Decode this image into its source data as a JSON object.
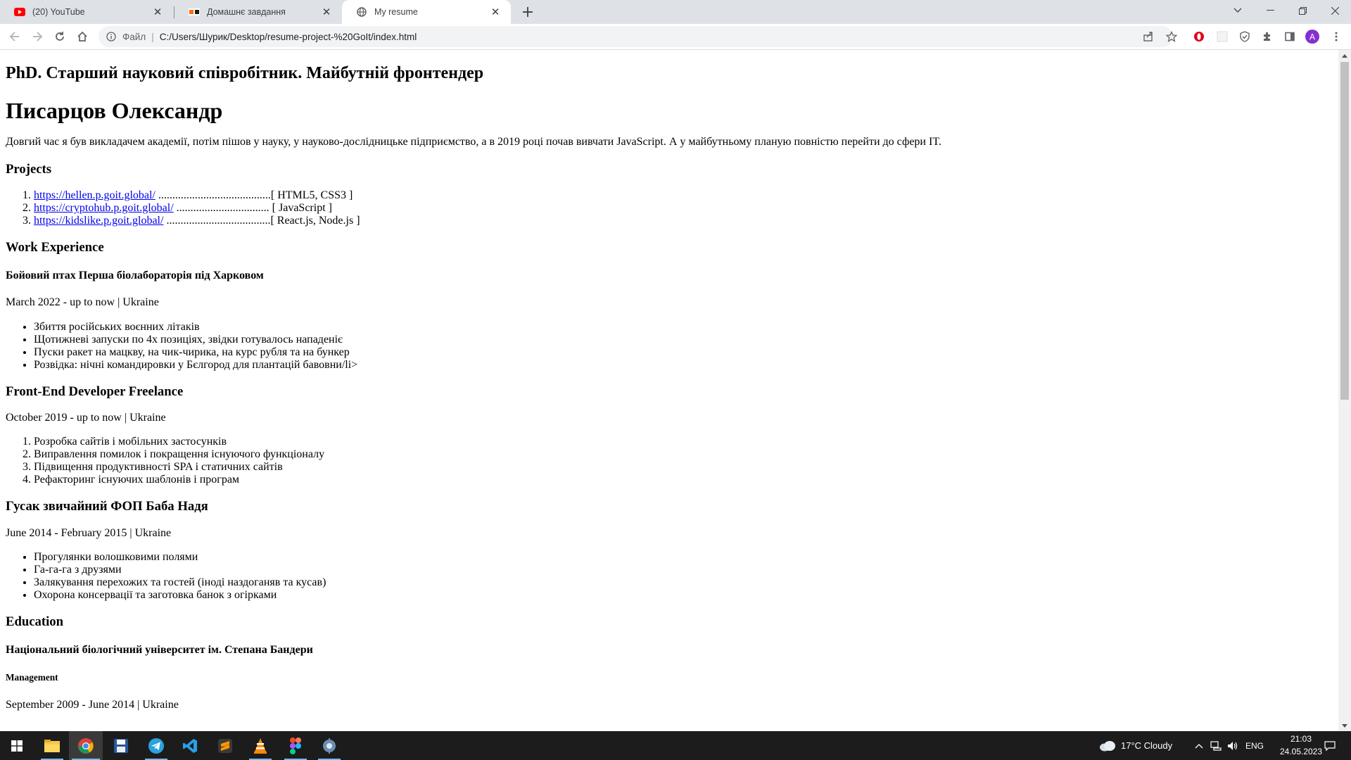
{
  "browser": {
    "tabs": [
      {
        "title": "(20) YouTube",
        "favicon": "youtube-icon"
      },
      {
        "title": "Домашнє завдання",
        "favicon": "goit-icon"
      },
      {
        "title": "My resume",
        "favicon": "globe-icon"
      }
    ],
    "address": {
      "scheme_label": "Файл",
      "url": "C:/Users/Шурик/Desktop/resume-project-%20GoIt/index.html"
    },
    "profile_initial": "A"
  },
  "resume": {
    "subtitle": "PhD. Старший науковий співробітник. Майбутній фронтендер",
    "name": "Писарцов Олександр",
    "intro": "Довгий час я був викладачем академії, потім пішов у науку, у науково-дослідницьке підприємство, а в 2019 році почав вивчати JavaScript. А у майбутньому планую повністю перейти до сфери IT.",
    "projects": {
      "heading": "Projects",
      "items": [
        {
          "url": "https://hellen.p.goit.global/",
          "dots": " ........................................",
          "tech": "[ HTML5, CSS3 ]"
        },
        {
          "url": "https://cryptohub.p.goit.global/",
          "dots": " ................................. ",
          "tech": "[ JavaScript ]"
        },
        {
          "url": "https://kidslike.p.goit.global/",
          "dots": " .....................................",
          "tech": "[ React.js, Node.js ]"
        }
      ]
    },
    "work": {
      "heading": "Work Experience",
      "job1": {
        "title": "Бойовий птах Перша біолабораторія під Харковом",
        "period": "March 2022 - up to now | Ukraine",
        "duties": [
          "Збиття російських воєнних літаків",
          "Щотижневі запуски по 4х позиціях, звідки готувалось нападеніє",
          "Пуски ракет на мацкву, на чик-чирика, на курс рубля та на бункер",
          "Розвідка: нічні командировки у Бєлгород для плантацій бавовни/li>"
        ]
      },
      "job2": {
        "title": "Front-End Developer Freelance",
        "period": "October 2019 - up to now | Ukraine",
        "duties": [
          "Розробка сайтів і мобільних застосунків",
          "Виправлення помилок і покращення існуючого функціоналу",
          "Підвищення продуктивності SPA і статичних сайтів",
          "Рефакторинг існуючих шаблонів і програм"
        ]
      },
      "job3": {
        "title": "Гусак звичайний ФОП Баба Надя",
        "period": "June 2014 - February 2015 | Ukraine",
        "duties": [
          "Прогулянки волошковими полями",
          "Га-га-га з друзями",
          "Залякування перехожих та гостей (іноді наздоганяв та кусав)",
          "Охорона консервації та заготовка банок з огірками"
        ]
      }
    },
    "education": {
      "heading": "Education",
      "university": "Національний біологічний університет ім. Степана Бандери",
      "faculty": "Management",
      "period": "September 2009 - June 2014 | Ukraine"
    }
  },
  "taskbar": {
    "weather": "17°C  Cloudy",
    "language": "ENG",
    "time": "21:03",
    "date": "24.05.2023"
  },
  "colors": {
    "tabstrip": "#dee1e6",
    "link": "#0000ee",
    "taskbar": "#1c1c1c",
    "accent": "#76b9ed"
  }
}
